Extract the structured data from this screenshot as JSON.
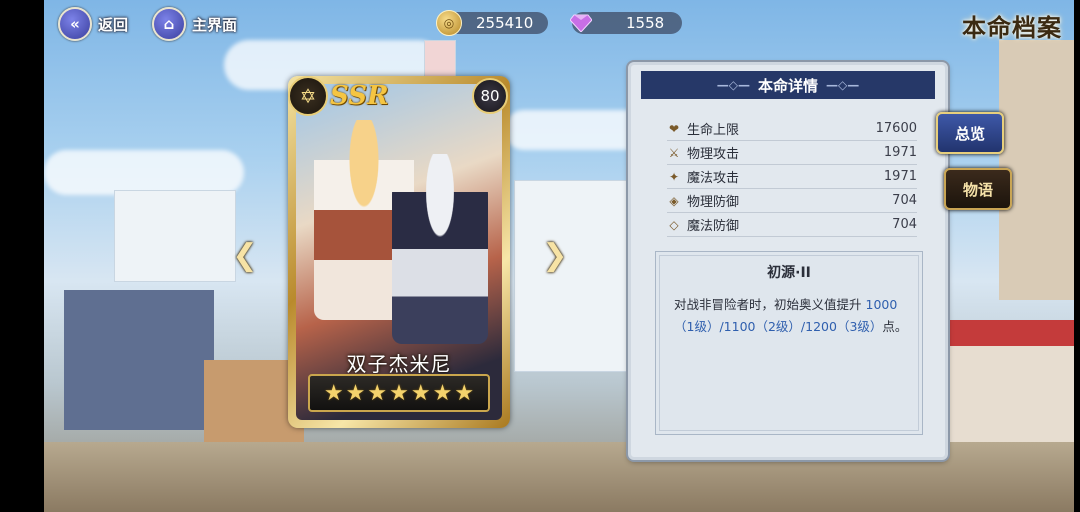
{
  "top_bar": {
    "back_label": "返回",
    "home_label": "主界面",
    "gold_value": "255410",
    "gem_value": "1558",
    "title": "本命档案"
  },
  "card": {
    "rarity": "SSR",
    "level": "80",
    "name": "双子杰米尼",
    "stars": 7
  },
  "panel": {
    "header": "本命详情",
    "stats": [
      {
        "icon": "heart-icon",
        "glyph": "❤",
        "name": "生命上限",
        "value": "17600"
      },
      {
        "icon": "sword-icon",
        "glyph": "⚔",
        "name": "物理攻击",
        "value": "1971"
      },
      {
        "icon": "wand-icon",
        "glyph": "✦",
        "name": "魔法攻击",
        "value": "1971"
      },
      {
        "icon": "shield-icon",
        "glyph": "◈",
        "name": "物理防御",
        "value": "704"
      },
      {
        "icon": "magic-shield-icon",
        "glyph": "◇",
        "name": "魔法防御",
        "value": "704"
      }
    ],
    "skill": {
      "title": "初源·II",
      "desc_prefix": "对战非冒险者时，初始奥义值提升",
      "desc_highlight": "1000（1级）/1100（2级）/1200（3级）",
      "desc_suffix": "点。"
    }
  },
  "side_tabs": {
    "overview": "总览",
    "story": "物语"
  },
  "colors": {
    "panel_header": "#263868",
    "highlight_text": "#2f5fae",
    "gold_trim": "#e7cf7d"
  }
}
